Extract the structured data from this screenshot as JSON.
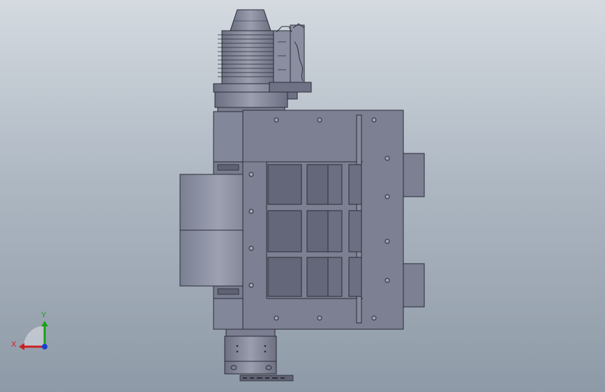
{
  "window": {
    "title": ""
  },
  "triad": {
    "x_label": "X",
    "y_label": "Y",
    "x_color": "#cc1f1f",
    "y_color": "#1aa01a",
    "z_color": "#1a3fd0"
  },
  "model": {
    "body_color": "#7c8092",
    "shadow_color": "#5f6272",
    "window_color": "#646779",
    "outline_color": "#2a2c36"
  }
}
